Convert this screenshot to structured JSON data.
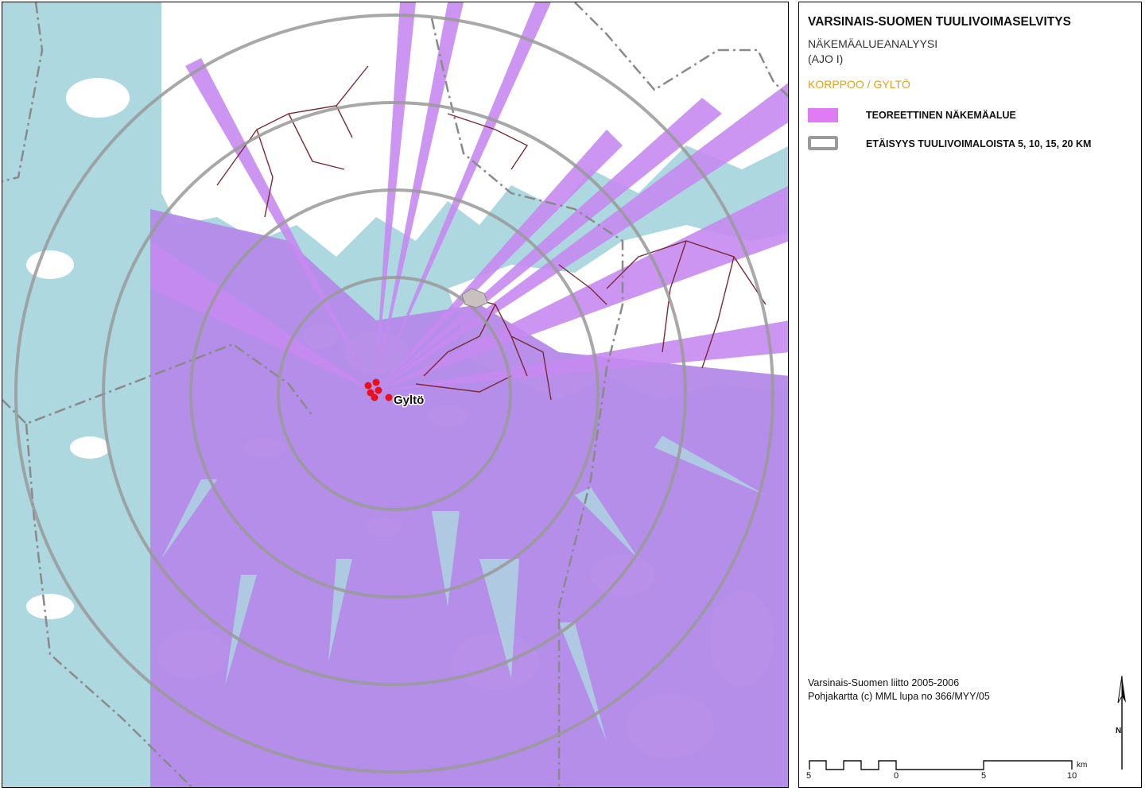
{
  "legend": {
    "title": "VARSINAIS-SUOMEN TUULIVOIMASELVITYS",
    "subtitle_line1": "NÄKEMÄALUEANALYYSI",
    "subtitle_line2": "(AJO I)",
    "place": "KORPPOO / GYLTÖ",
    "items": [
      {
        "label": "TEOREETTINEN NÄKEMÄALUE",
        "color": "#e07cf3",
        "symbol": "filled-rectangle"
      },
      {
        "label": "ETÄISYYS TUULIVOIMALOISTA 5, 10, 15, 20 KM",
        "color": "#9a9a9a",
        "symbol": "ring-outline"
      }
    ],
    "credit_line1": "Varsinais-Suomen liitto 2005-2006",
    "credit_line2": "Pohjakartta (c) MML lupa no 366/MYY/05"
  },
  "map": {
    "place_label": "Gyltö",
    "distance_rings_km": [
      5,
      10,
      15,
      20
    ],
    "turbine_count": 6,
    "colors": {
      "sea": "#add8e0",
      "land": "#ffffff",
      "visibility": "#b48ae8",
      "visibility_bright": "#c68af0",
      "rings": "#9a9a9a",
      "roads": "#7a2a35",
      "boundary": "#8a8a8a",
      "turbines": "#e8101e"
    }
  },
  "scale_bar": {
    "labels": [
      "5",
      "0",
      "5",
      "10"
    ],
    "unit": "km"
  },
  "north_arrow": {
    "label": "N"
  }
}
